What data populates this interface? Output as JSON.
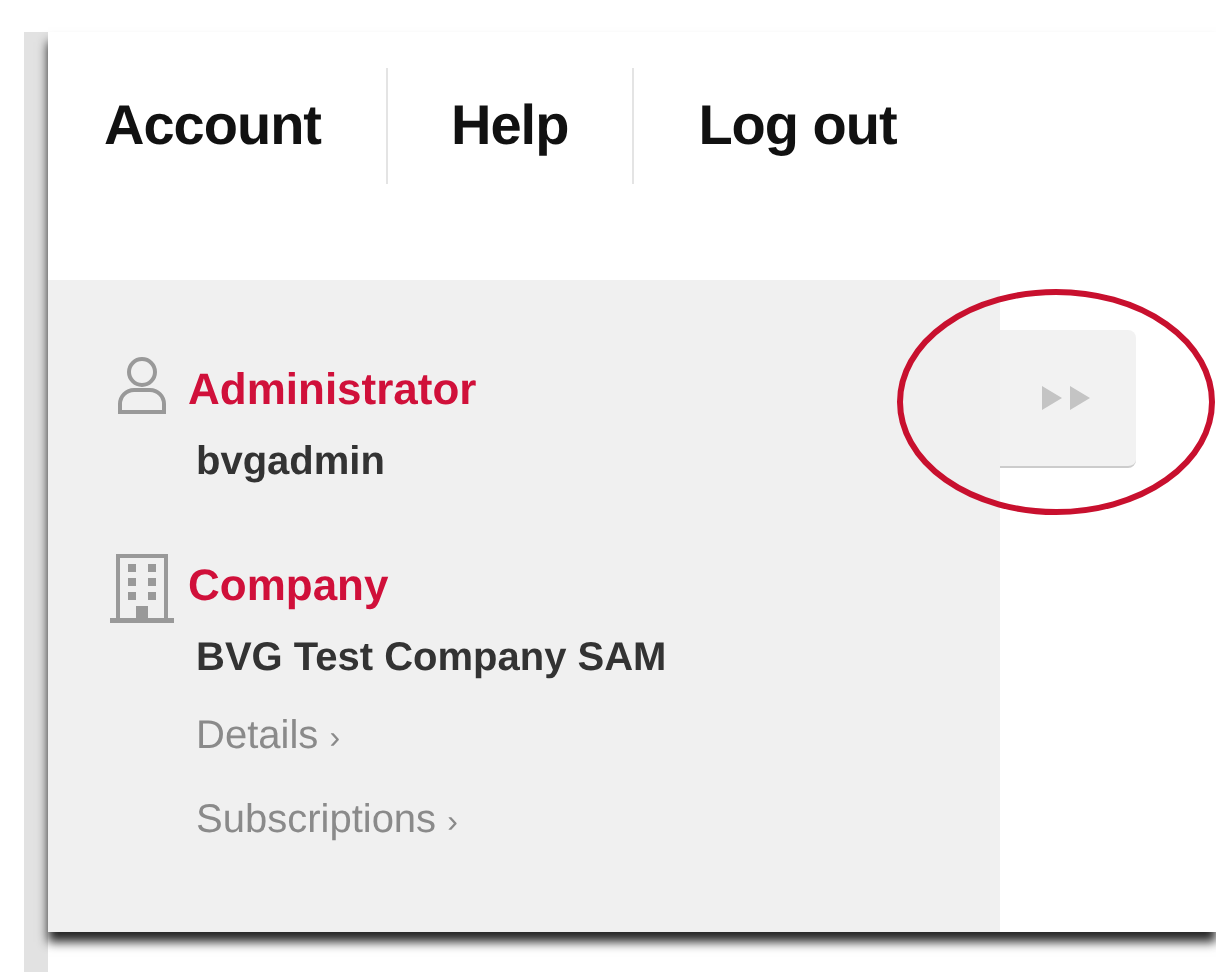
{
  "nav": [
    {
      "label": "Account"
    },
    {
      "label": "Help"
    },
    {
      "label": "Log out"
    }
  ],
  "sidebar": {
    "sections": [
      {
        "kind": "user",
        "heading": "Administrator",
        "value": "bvgadmin"
      },
      {
        "kind": "company",
        "heading": "Company",
        "value": "BVG Test Company SAM",
        "links": [
          {
            "label": "Details",
            "chevron": "›"
          },
          {
            "label": "Subscriptions",
            "chevron": "›"
          }
        ]
      }
    ]
  },
  "expand_button": {
    "highlighted": true
  }
}
